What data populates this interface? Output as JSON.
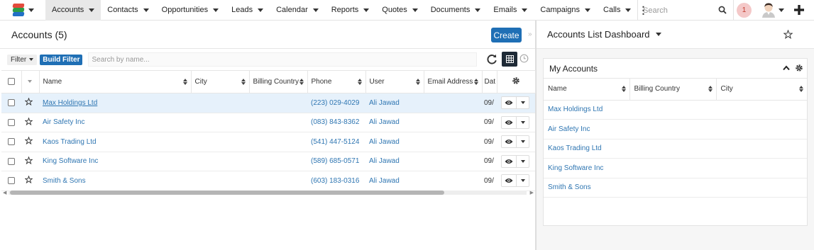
{
  "nav": {
    "items": [
      {
        "label": "Accounts",
        "active": true
      },
      {
        "label": "Contacts"
      },
      {
        "label": "Opportunities"
      },
      {
        "label": "Leads"
      },
      {
        "label": "Calendar"
      },
      {
        "label": "Reports"
      },
      {
        "label": "Quotes"
      },
      {
        "label": "Documents"
      },
      {
        "label": "Emails"
      },
      {
        "label": "Campaigns"
      },
      {
        "label": "Calls"
      }
    ],
    "search_placeholder": "Search",
    "notification_count": "1"
  },
  "list": {
    "title": "Accounts (5)",
    "create_label": "Create",
    "filter_label": "Filter",
    "build_filter_label": "Build Filter",
    "search_placeholder": "Search by name...",
    "columns": {
      "name": "Name",
      "city": "City",
      "billing_country": "Billing Country",
      "phone": "Phone",
      "user": "User",
      "email": "Email Address",
      "date": "Dat"
    },
    "rows": [
      {
        "name": "Max Holdings Ltd",
        "city": "",
        "country": "",
        "phone": "(223) 029-4029",
        "user": "Ali Jawad",
        "email": "",
        "date": "09/"
      },
      {
        "name": "Air Safety Inc",
        "city": "",
        "country": "",
        "phone": "(083) 843-8362",
        "user": "Ali Jawad",
        "email": "",
        "date": "09/"
      },
      {
        "name": "Kaos Trading Ltd",
        "city": "",
        "country": "",
        "phone": "(541) 447-5124",
        "user": "Ali Jawad",
        "email": "",
        "date": "09/"
      },
      {
        "name": "King Software Inc",
        "city": "",
        "country": "",
        "phone": "(589) 685-0571",
        "user": "Ali Jawad",
        "email": "",
        "date": "09/"
      },
      {
        "name": "Smith & Sons",
        "city": "",
        "country": "",
        "phone": "(603) 183-0316",
        "user": "Ali Jawad",
        "email": "",
        "date": "09/"
      }
    ]
  },
  "dashboard": {
    "title": "Accounts List Dashboard",
    "dashlet_title": "My Accounts",
    "columns": {
      "name": "Name",
      "billing_country": "Billing Country",
      "city": "City"
    },
    "rows": [
      {
        "name": "Max Holdings Ltd"
      },
      {
        "name": "Air Safety Inc"
      },
      {
        "name": "Kaos Trading Ltd"
      },
      {
        "name": "King Software Inc"
      },
      {
        "name": "Smith & Sons"
      }
    ]
  },
  "colors": {
    "accent": "#1f6fb5",
    "link": "#2f76b2",
    "selected_row": "#e6f1fb"
  }
}
